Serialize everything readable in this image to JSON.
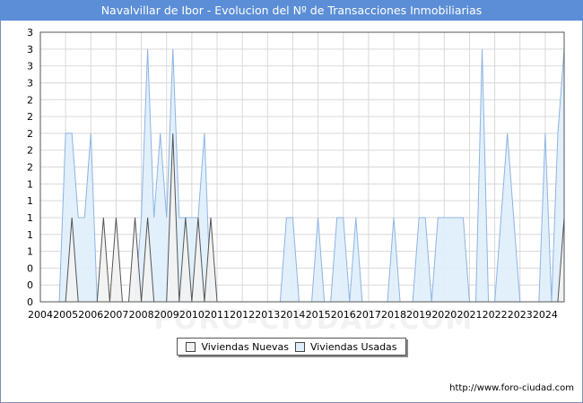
{
  "header": {
    "title": "Navalvillar de Ibor - Evolucion del Nº de Transacciones Inmobiliarias"
  },
  "footer": {
    "url": "http://www.foro-ciudad.com"
  },
  "watermark": {
    "text": "FORO-CIUDAD.COM"
  },
  "colors": {
    "title_bg": "#5b8ed6",
    "nuevas_fill": "#f2f2f2",
    "nuevas_stroke": "#555555",
    "usadas_fill": "#dfeefc",
    "usadas_stroke": "#8db4e2",
    "grid": "#d9d9d9"
  },
  "chart_data": {
    "type": "area",
    "title": "Navalvillar de Ibor - Evolucion del Nº de Transacciones Inmobiliarias",
    "xlabel": "",
    "ylabel": "",
    "x_range": [
      2004,
      2024.75
    ],
    "y_range": [
      0,
      3.2
    ],
    "x_ticks": [
      "2004",
      "2005",
      "2006",
      "2007",
      "2008",
      "2009",
      "2010",
      "2011",
      "2012",
      "2013",
      "2014",
      "2015",
      "2016",
      "2017",
      "2018",
      "2019",
      "2020",
      "2021",
      "2022",
      "2023",
      "2024"
    ],
    "y_ticks": [
      "0",
      "0",
      "0",
      "1",
      "1",
      "1",
      "1",
      "1",
      "2",
      "2",
      "2",
      "2",
      "2",
      "3",
      "3",
      "3",
      "3"
    ],
    "grid": true,
    "legend_position": "bottom",
    "series": [
      {
        "name": "Viviendas Nuevas",
        "points": [
          [
            2004.75,
            0
          ],
          [
            2005,
            0
          ],
          [
            2005.25,
            1
          ],
          [
            2005.5,
            0
          ],
          [
            2005.75,
            0
          ],
          [
            2006,
            0
          ],
          [
            2006.25,
            0
          ],
          [
            2006.5,
            1
          ],
          [
            2006.75,
            0
          ],
          [
            2007,
            1
          ],
          [
            2007.25,
            0
          ],
          [
            2007.5,
            0
          ],
          [
            2007.75,
            1
          ],
          [
            2008,
            0
          ],
          [
            2008.25,
            1
          ],
          [
            2008.5,
            0
          ],
          [
            2008.75,
            0
          ],
          [
            2009,
            0
          ],
          [
            2009.25,
            2
          ],
          [
            2009.5,
            0
          ],
          [
            2009.75,
            1
          ],
          [
            2010,
            0
          ],
          [
            2010.25,
            1
          ],
          [
            2010.5,
            0
          ],
          [
            2010.75,
            1
          ],
          [
            2011,
            0
          ],
          [
            2011.25,
            0
          ],
          [
            2024.5,
            0
          ],
          [
            2024.75,
            1
          ]
        ]
      },
      {
        "name": "Viviendas Usadas",
        "points": [
          [
            2004.75,
            0
          ],
          [
            2005,
            2
          ],
          [
            2005.25,
            2
          ],
          [
            2005.5,
            1
          ],
          [
            2005.75,
            1
          ],
          [
            2006,
            2
          ],
          [
            2006.25,
            0
          ],
          [
            2006.5,
            0
          ],
          [
            2007,
            0
          ],
          [
            2007.25,
            0
          ],
          [
            2007.5,
            0
          ],
          [
            2007.75,
            0
          ],
          [
            2008,
            1
          ],
          [
            2008.25,
            3
          ],
          [
            2008.5,
            1
          ],
          [
            2008.75,
            2
          ],
          [
            2009,
            1
          ],
          [
            2009.25,
            3
          ],
          [
            2009.5,
            1
          ],
          [
            2009.75,
            1
          ],
          [
            2010,
            1
          ],
          [
            2010.25,
            1
          ],
          [
            2010.5,
            2
          ],
          [
            2010.75,
            0
          ],
          [
            2011,
            0
          ],
          [
            2013.5,
            0
          ],
          [
            2013.75,
            1
          ],
          [
            2014,
            1
          ],
          [
            2014.25,
            0
          ],
          [
            2014.75,
            0
          ],
          [
            2015,
            1
          ],
          [
            2015.25,
            0
          ],
          [
            2015.5,
            0
          ],
          [
            2015.75,
            1
          ],
          [
            2016,
            1
          ],
          [
            2016.25,
            0
          ],
          [
            2016.5,
            1
          ],
          [
            2016.75,
            0
          ],
          [
            2017,
            0
          ],
          [
            2017.75,
            0
          ],
          [
            2018,
            1
          ],
          [
            2018.25,
            0
          ],
          [
            2018.75,
            0
          ],
          [
            2019,
            1
          ],
          [
            2019.25,
            1
          ],
          [
            2019.5,
            0
          ],
          [
            2019.75,
            1
          ],
          [
            2020,
            1
          ],
          [
            2020.25,
            1
          ],
          [
            2020.5,
            1
          ],
          [
            2020.75,
            1
          ],
          [
            2021,
            0
          ],
          [
            2021.25,
            0
          ],
          [
            2021.5,
            3
          ],
          [
            2021.75,
            0
          ],
          [
            2022,
            0
          ],
          [
            2022.5,
            2
          ],
          [
            2022.75,
            1
          ],
          [
            2023,
            0
          ],
          [
            2023.75,
            0
          ],
          [
            2024,
            2
          ],
          [
            2024.25,
            0
          ],
          [
            2024.5,
            2
          ],
          [
            2024.75,
            3
          ]
        ]
      }
    ]
  }
}
